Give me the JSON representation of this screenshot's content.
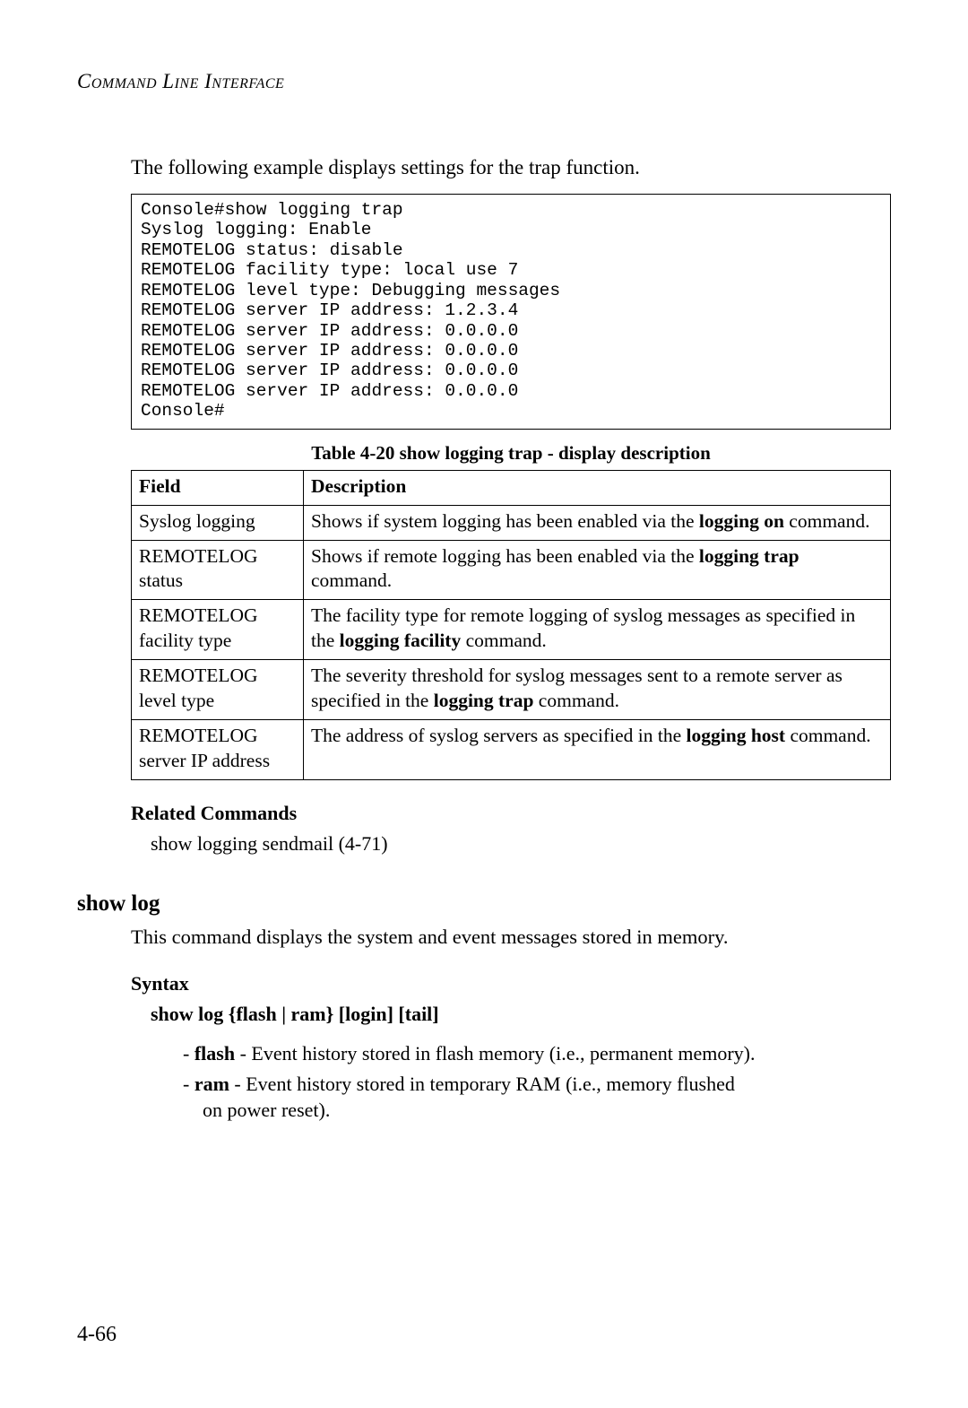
{
  "running_head": "Command Line Interface",
  "intro": "The following example displays settings for the trap function.",
  "console_lines": [
    "Console#show logging trap",
    "Syslog logging: Enable",
    "REMOTELOG status: disable",
    "REMOTELOG facility type: local use 7",
    "REMOTELOG level type: Debugging messages",
    "REMOTELOG server IP address: 1.2.3.4",
    "REMOTELOG server IP address: 0.0.0.0",
    "REMOTELOG server IP address: 0.0.0.0",
    "REMOTELOG server IP address: 0.0.0.0",
    "REMOTELOG server IP address: 0.0.0.0",
    "Console#"
  ],
  "table": {
    "caption": "Table 4-20  show logging trap - display description",
    "header": {
      "field": "Field",
      "description": "Description"
    },
    "rows": [
      {
        "field": "Syslog logging",
        "desc_pre": "Shows if system logging has been enabled via the ",
        "desc_bold": "logging on",
        "desc_post": " command."
      },
      {
        "field": "REMOTELOG status",
        "desc_pre": "Shows if remote logging has been enabled via the ",
        "desc_bold": "logging trap",
        "desc_post": " command."
      },
      {
        "field": "REMOTELOG facility type",
        "desc_pre": "The facility type for remote logging of syslog messages as specified in the ",
        "desc_bold": "logging facility",
        "desc_post": " command."
      },
      {
        "field": "REMOTELOG level type",
        "desc_pre": "The severity threshold for syslog messages sent to a remote server as specified in the ",
        "desc_bold": "logging trap",
        "desc_post": " command."
      },
      {
        "field": "REMOTELOG server IP address",
        "desc_pre": "The address of syslog servers as specified in the ",
        "desc_bold": "logging host",
        "desc_post": " command."
      }
    ]
  },
  "related": {
    "heading": "Related Commands",
    "item": "show logging sendmail (4-71)"
  },
  "cmd": {
    "title": "show log",
    "desc": "This command displays the system and event messages stored in memory.",
    "syntax_heading": "Syntax",
    "syntax_line": "show log {flash | ram} [login] [tail]",
    "options": [
      {
        "bold": "flash",
        "rest": " - Event history stored in flash memory (i.e., permanent memory)."
      },
      {
        "bold": "ram",
        "rest": " - Event history stored in temporary RAM (i.e., memory flushed on power reset)."
      }
    ]
  },
  "page_number": "4-66"
}
